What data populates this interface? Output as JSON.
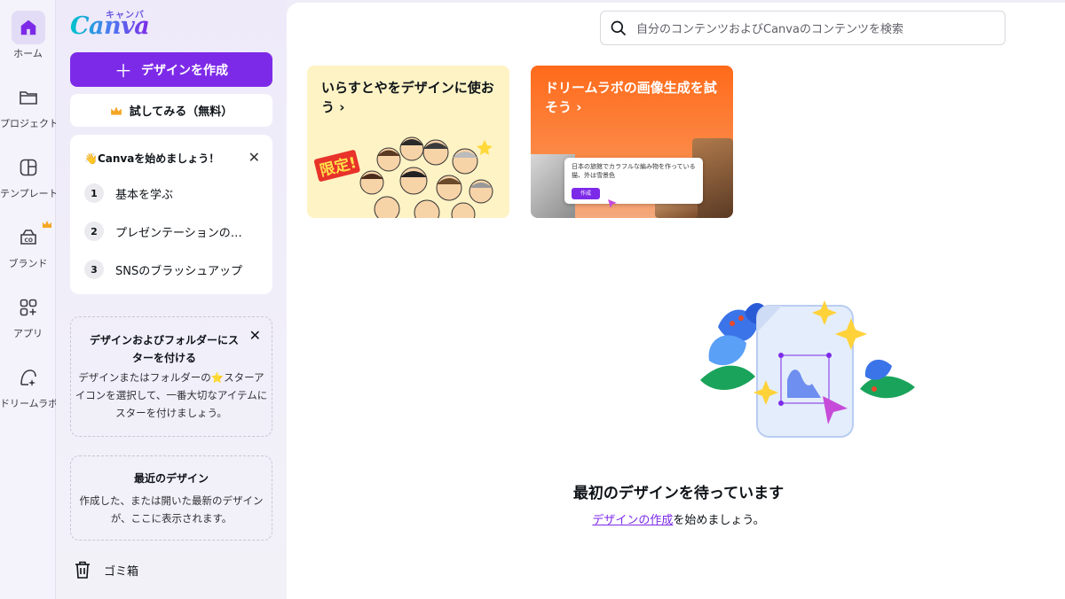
{
  "app": {
    "logo_text": "Canva",
    "logo_kana": "キャンバ",
    "brand_color": "#7d2ae8"
  },
  "rail": {
    "items": [
      {
        "label": "ホーム",
        "icon": "home-icon",
        "active": true
      },
      {
        "label": "プロジェクト",
        "icon": "folder-icon"
      },
      {
        "label": "テンプレート",
        "icon": "template-icon"
      },
      {
        "label": "ブランド",
        "icon": "brand-icon",
        "badge": "crown-icon"
      },
      {
        "label": "アプリ",
        "icon": "apps-icon"
      },
      {
        "label": "ドリームラボ",
        "icon": "dream-lab-icon"
      }
    ]
  },
  "panel": {
    "create_label": "デザインを作成",
    "trial_label": "試してみる（無料）",
    "start": {
      "title": "👋Canvaを始めましょう！",
      "steps": [
        {
          "num": "1",
          "label": "基本を学ぶ"
        },
        {
          "num": "2",
          "label": "プレゼンテーションの…"
        },
        {
          "num": "3",
          "label": "SNSのブラッシュアップ"
        }
      ]
    },
    "star_tip": {
      "title": "デザインおよびフォルダーにスターを付ける",
      "body": "デザインまたはフォルダーの⭐スターアイコンを選択して、一番大切なアイテムにスターを付けましょう。"
    },
    "recent": {
      "title": "最近のデザイン",
      "body": "作成した、または開いた最新のデザインが、ここに表示されます。"
    },
    "trash_label": "ゴミ箱"
  },
  "main": {
    "search_placeholder": "自分のコンテンツおよびCanvaのコンテンツを検索",
    "promos": [
      {
        "title": "いらすとやをデザインに使おう ›",
        "badge": "限定!"
      },
      {
        "title": "ドリームラボの画像生成を試そう ›",
        "prompt": "日本の旅館でカラフルな編み物を作っている猫、外は雪景色",
        "button": "作成"
      }
    ],
    "empty_title": "最初のデザインを待っています",
    "empty_link": "デザインの作成",
    "empty_suffix": "を始めましょう。"
  }
}
